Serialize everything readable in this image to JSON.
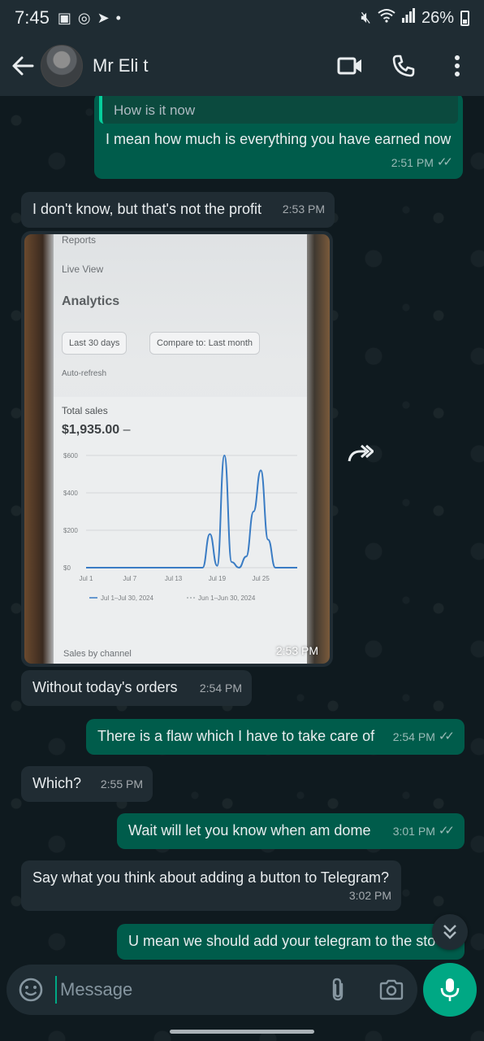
{
  "status_bar": {
    "time": "7:45",
    "battery": "26%"
  },
  "header": {
    "contact_name": "Mr Eli t"
  },
  "messages": [
    {
      "direction": "out",
      "quoted": "How is it now",
      "text": "I mean how much is everything you have earned now",
      "time": "2:51 PM"
    },
    {
      "direction": "in",
      "text": "I don't know, but that's not the profit",
      "time": "2:53 PM"
    },
    {
      "direction": "in",
      "type": "image",
      "time": "2:53 PM",
      "image": {
        "menu_reports": "Reports",
        "menu_live_view": "Live View",
        "heading": "Analytics",
        "chip_range": "Last 30 days",
        "chip_compare": "Compare to: Last month",
        "auto_refresh": "Auto-refresh",
        "card_title": "Total sales",
        "card_value": "$1,935.00",
        "card_value_suffix": "–",
        "footer_text": "Sales by channel"
      }
    },
    {
      "direction": "in",
      "text": "Without today's orders",
      "time": "2:54 PM"
    },
    {
      "direction": "out",
      "text": "There is a flaw which I have to take care of",
      "time": "2:54 PM"
    },
    {
      "direction": "in",
      "text": "Which?",
      "time": "2:55 PM"
    },
    {
      "direction": "out",
      "text": "Wait will let you know when am dome",
      "time": "3:01 PM"
    },
    {
      "direction": "in",
      "text": "Say what you think about adding a button to Telegram?",
      "time": "3:02 PM"
    },
    {
      "direction": "out",
      "text": "U mean we should add your telegram to the sto"
    }
  ],
  "composer": {
    "placeholder": "Message"
  },
  "chart_data": {
    "type": "line",
    "ylim": [
      0,
      600
    ],
    "y_ticks": [
      "$600",
      "$400",
      "$200",
      "$0"
    ],
    "x_tick_labels": [
      "Jul 1",
      "Jul 7",
      "Jul 13",
      "Jul 19",
      "Jul 25"
    ],
    "x": [
      "Jul 1",
      "Jul 2",
      "Jul 3",
      "Jul 4",
      "Jul 5",
      "Jul 6",
      "Jul 7",
      "Jul 8",
      "Jul 9",
      "Jul 10",
      "Jul 11",
      "Jul 12",
      "Jul 13",
      "Jul 14",
      "Jul 15",
      "Jul 16",
      "Jul 17",
      "Jul 18",
      "Jul 19",
      "Jul 20",
      "Jul 21",
      "Jul 22",
      "Jul 23",
      "Jul 24",
      "Jul 25",
      "Jul 26",
      "Jul 27",
      "Jul 28",
      "Jul 29",
      "Jul 30"
    ],
    "series": [
      {
        "name": "Jul 1–Jul 30, 2024",
        "values": [
          0,
          0,
          0,
          0,
          0,
          0,
          0,
          0,
          0,
          0,
          0,
          0,
          0,
          0,
          0,
          0,
          0,
          180,
          10,
          600,
          30,
          0,
          60,
          300,
          520,
          150,
          0,
          0,
          0,
          0
        ]
      }
    ],
    "legend": [
      "Jul 1–Jul 30, 2024",
      "Jun 1–Jun 30, 2024"
    ],
    "colors": {
      "line": "#3a7cc4"
    }
  }
}
